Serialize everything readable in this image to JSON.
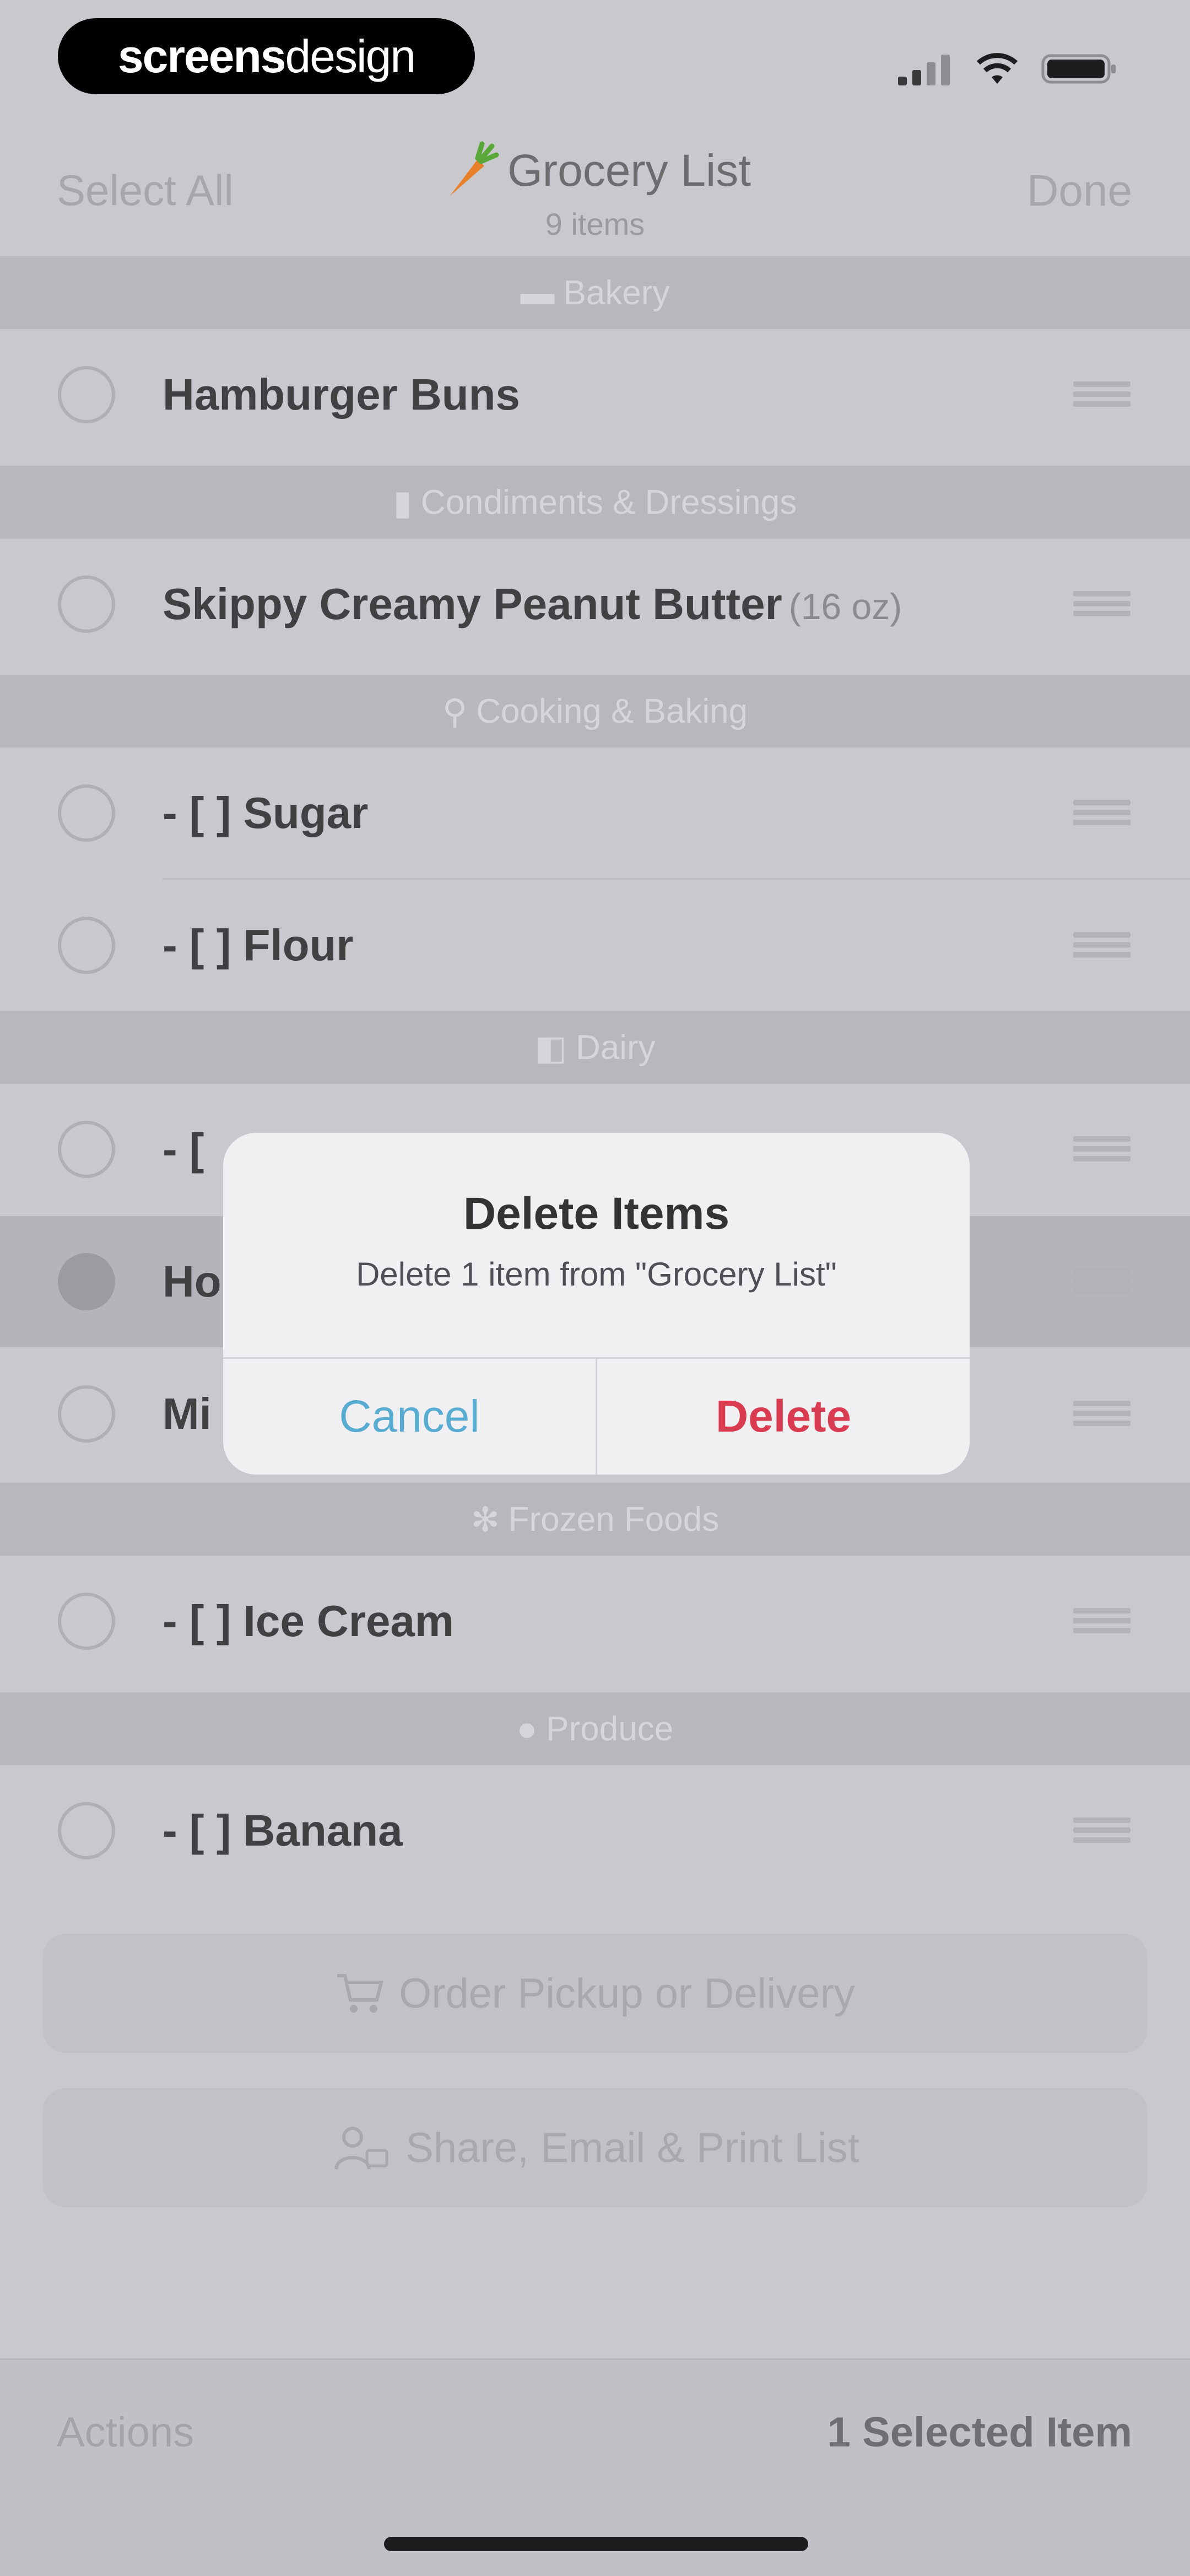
{
  "status_bar": {
    "brand_strong": "screens",
    "brand_light": "design"
  },
  "nav": {
    "left": "Select All",
    "title": "Grocery List",
    "subtitle": "9 items",
    "right": "Done"
  },
  "list": {
    "sections": [
      "Bakery",
      "Condiments & Dressings",
      "Cooking & Baking",
      "Dairy",
      "Frozen Foods",
      "Produce"
    ],
    "items": [
      {
        "label": "Hamburger Buns",
        "qty": "",
        "checked": false
      },
      {
        "label": "Skippy Creamy Peanut Butter",
        "qty": "(16 oz)",
        "checked": false
      },
      {
        "label": "- [ ] Sugar",
        "qty": "",
        "checked": false
      },
      {
        "label": "- [ ] Flour",
        "qty": "",
        "checked": false
      },
      {
        "label": "- [",
        "qty": "",
        "checked": false
      },
      {
        "label": "Ho",
        "qty": "",
        "checked": true
      },
      {
        "label": "Mi",
        "qty": "",
        "checked": false
      },
      {
        "label": "- [ ] Ice Cream",
        "qty": "",
        "checked": false
      },
      {
        "label": "- [ ] Banana",
        "qty": "",
        "checked": false
      }
    ]
  },
  "actions": {
    "order": "Order Pickup or Delivery",
    "share": "Share, Email & Print List"
  },
  "toolbar": {
    "left": "Actions",
    "right": "1 Selected Item"
  },
  "alert": {
    "title": "Delete Items",
    "message": "Delete 1 item from \"Grocery List\"",
    "cancel": "Cancel",
    "delete": "Delete"
  },
  "colors": {
    "accent": "#58abd1",
    "destructive": "#d93c50",
    "carrot": "#e8802a"
  }
}
